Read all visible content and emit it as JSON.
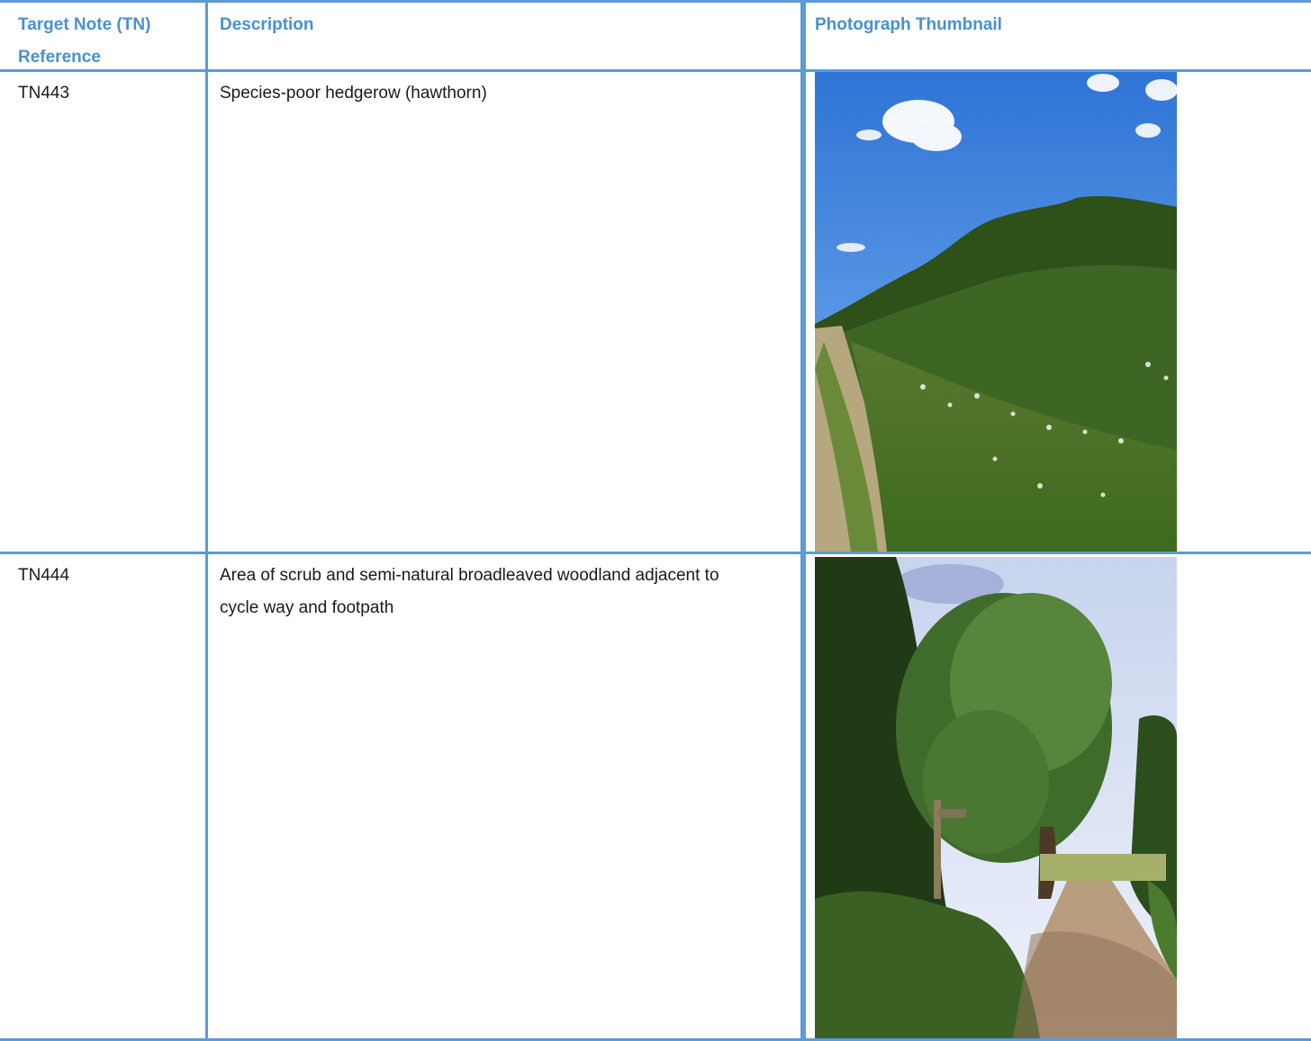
{
  "headers": {
    "reference": "Target Note (TN) Reference",
    "description": "Description",
    "photo": "Photograph Thumbnail"
  },
  "rows": [
    {
      "reference": "TN443",
      "description": "Species-poor hedgerow (hawthorn)",
      "photo_icon": "hedgerow-photo"
    },
    {
      "reference": "TN444",
      "description": "Area of scrub and semi-natural broadleaved woodland adjacent to cycle way and footpath",
      "photo_icon": "woodland-path-photo"
    }
  ],
  "colors": {
    "grid": "#5b9bd5",
    "header_text": "#4a90cf"
  }
}
